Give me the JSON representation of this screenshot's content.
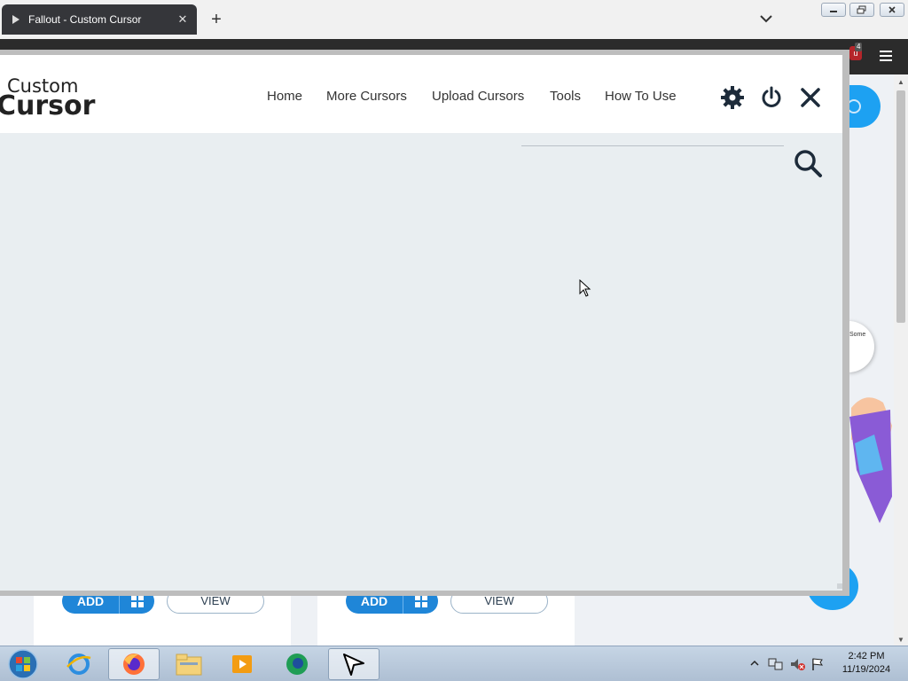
{
  "browser": {
    "tab_title": "Fallout - Custom Cursor",
    "new_tab_symbol": "+",
    "tab_close_symbol": "✕",
    "extension_badge_count": "4"
  },
  "overlay": {
    "logo_line1": "Custom",
    "logo_line2": "Cursor",
    "nav": [
      "Home",
      "More Cursors",
      "Upload Cursors",
      "Tools",
      "How To Use"
    ],
    "icons": [
      "gear-icon",
      "power-icon",
      "close-icon",
      "search-icon"
    ],
    "accent_color": "#1d2b3a"
  },
  "background_page": {
    "add_label": "ADD",
    "view_label": "VIEW",
    "bubble_text": "Some",
    "brand_color": "#1f86d8"
  },
  "taskbar": {
    "time": "2:42 PM",
    "date": "11/19/2024",
    "apps": [
      "start-orb",
      "internet-explorer-icon",
      "firefox-icon",
      "file-explorer-icon",
      "media-player-icon",
      "app-green-icon",
      "custom-cursor-icon"
    ]
  }
}
